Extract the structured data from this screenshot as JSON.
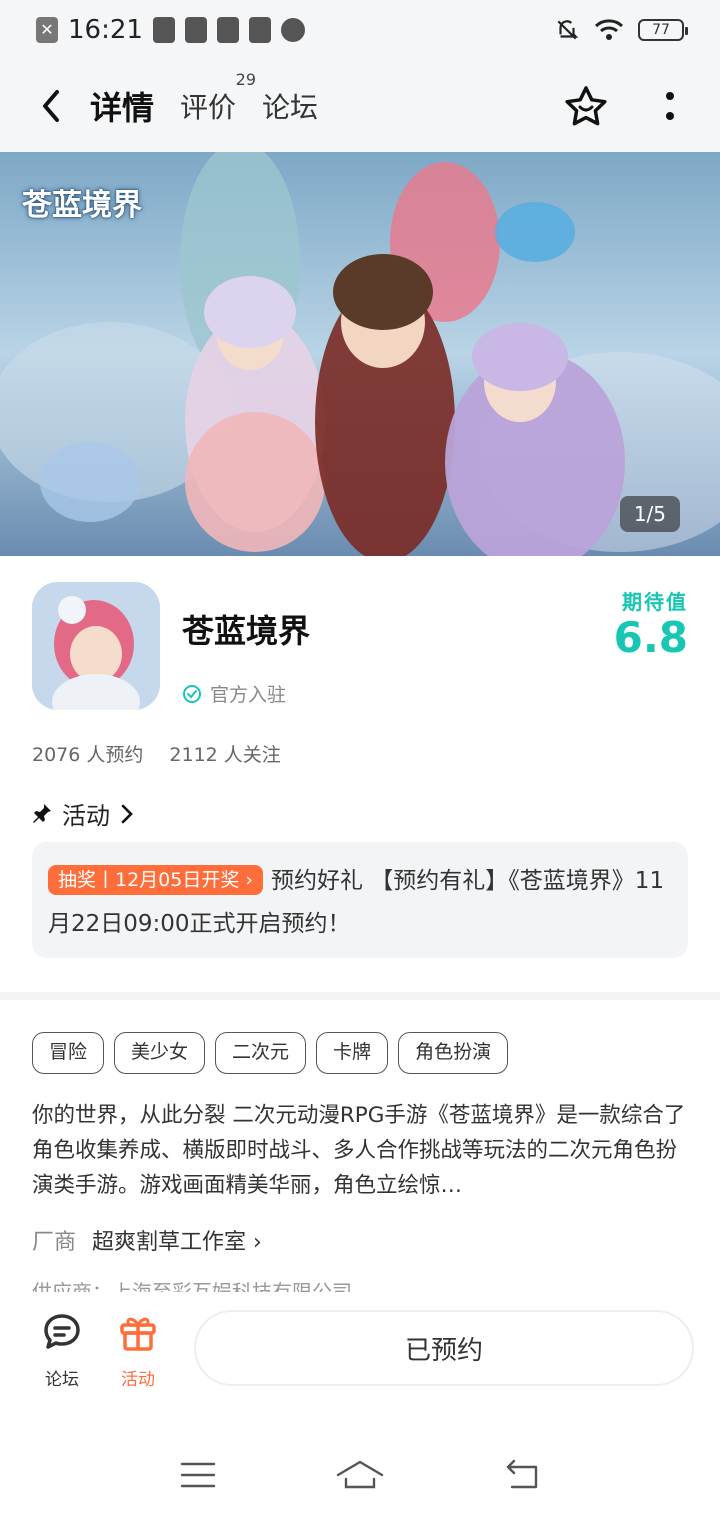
{
  "status_bar": {
    "time": "16:21",
    "battery": "77"
  },
  "nav": {
    "tabs": [
      {
        "label": "详情"
      },
      {
        "label": "评价",
        "count": "29"
      },
      {
        "label": "论坛"
      }
    ]
  },
  "banner": {
    "logo_text": "苍蓝境界",
    "page_indicator": "1/5"
  },
  "app": {
    "name": "苍蓝境界",
    "official_label": "官方入驻",
    "expect_label": "期待值",
    "expect_value": "6.8"
  },
  "stats": {
    "reservations": "2076 人预约",
    "followers": "2112 人关注"
  },
  "activity": {
    "title": "活动",
    "badge": "抽奖丨12月05日开奖 ›",
    "text": "预约好礼 【预约有礼】《苍蓝境界》11月22日09:00正式开启预约！"
  },
  "tags": [
    "冒险",
    "美少女",
    "二次元",
    "卡牌",
    "角色扮演"
  ],
  "description": "你的世界，从此分裂 二次元动漫RPG手游《苍蓝境界》是一款综合了角色收集养成、横版即时战斗、多人合作挑战等玩法的二次元角色扮演类手游。游戏画面精美华丽，角色立绘惊…",
  "vendor": {
    "label": "厂商",
    "name": "超爽割草工作室 ›"
  },
  "publisher_peek": "供应商：上海至彩互娱科技有限公司",
  "bottom": {
    "forum_label": "论坛",
    "activity_label": "活动",
    "reserve_button": "已预约"
  },
  "colors": {
    "accent": "#17c7b4",
    "orange": "#ff6d3b"
  }
}
